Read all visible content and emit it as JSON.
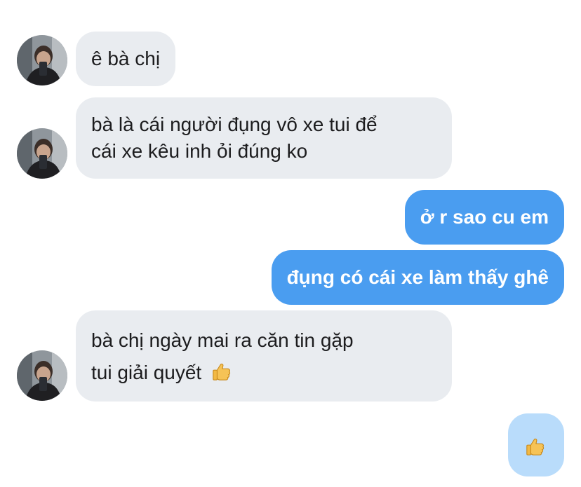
{
  "conversation": {
    "messages": [
      {
        "sender": "other",
        "lines": [
          "ê bà chị"
        ]
      },
      {
        "sender": "other",
        "lines": [
          "bà là cái người đụng vô xe tui để",
          "cái xe kêu inh ỏi đúng ko"
        ]
      },
      {
        "sender": "me",
        "lines": [
          "ở r sao cu em"
        ]
      },
      {
        "sender": "me",
        "lines": [
          "đụng có cái xe làm thấy ghê"
        ]
      },
      {
        "sender": "other",
        "lines": [
          "bà chị ngày mai ra căn tin gặp",
          "tui giải quyết"
        ],
        "emoji": "thumbs-up-icon"
      },
      {
        "sender": "me",
        "lines": [],
        "emoji": "thumbs-up-icon"
      }
    ]
  },
  "colors": {
    "incoming_bubble": "#e9ecf0",
    "outgoing_bubble": "#4a9df0",
    "outgoing_emoji_bubble": "#b9dcfb"
  }
}
